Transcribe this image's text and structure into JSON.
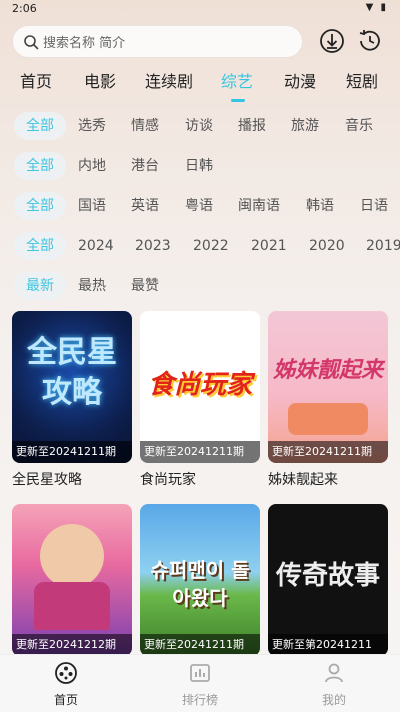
{
  "status_bar": {
    "time": "2:06",
    "icons": "▼ ▮"
  },
  "search": {
    "placeholder": "搜索名称 简介"
  },
  "top_buttons": [
    "download-icon",
    "history-icon"
  ],
  "main_tabs": [
    {
      "label": "首页",
      "active": false
    },
    {
      "label": "电影",
      "active": false
    },
    {
      "label": "连续剧",
      "active": false
    },
    {
      "label": "综艺",
      "active": true
    },
    {
      "label": "动漫",
      "active": false
    },
    {
      "label": "短剧",
      "active": false
    }
  ],
  "filters": {
    "genre": [
      "全部",
      "选秀",
      "情感",
      "访谈",
      "播报",
      "旅游",
      "音乐"
    ],
    "region": [
      "全部",
      "内地",
      "港台",
      "日韩"
    ],
    "language": [
      "全部",
      "国语",
      "英语",
      "粤语",
      "闽南语",
      "韩语",
      "日语"
    ],
    "year": [
      "全部",
      "2024",
      "2023",
      "2022",
      "2021",
      "2020",
      "2019"
    ],
    "sort": [
      "最新",
      "最热",
      "最赞"
    ]
  },
  "shows": [
    {
      "title": "全民星攻略",
      "update": "更新至20241211期",
      "art": "全民星攻略"
    },
    {
      "title": "食尚玩家",
      "update": "更新至20241211期",
      "art": "食尚玩家"
    },
    {
      "title": "姊妹靓起来",
      "update": "更新至20241211期",
      "art": "姊妹靓起来"
    },
    {
      "title": "",
      "update": "更新至20241212期",
      "art": ""
    },
    {
      "title": "",
      "update": "更新至20241211期",
      "art": "슈퍼맨이 돌아왔다"
    },
    {
      "title": "",
      "update": "更新至第20241211",
      "art": "传奇故事"
    }
  ],
  "bottom_nav": [
    {
      "label": "首页",
      "icon": "home-film-icon",
      "active": true
    },
    {
      "label": "排行榜",
      "icon": "ranking-icon",
      "active": false
    },
    {
      "label": "我的",
      "icon": "profile-icon",
      "active": false
    }
  ],
  "colors": {
    "accent": "#34c6e0"
  }
}
